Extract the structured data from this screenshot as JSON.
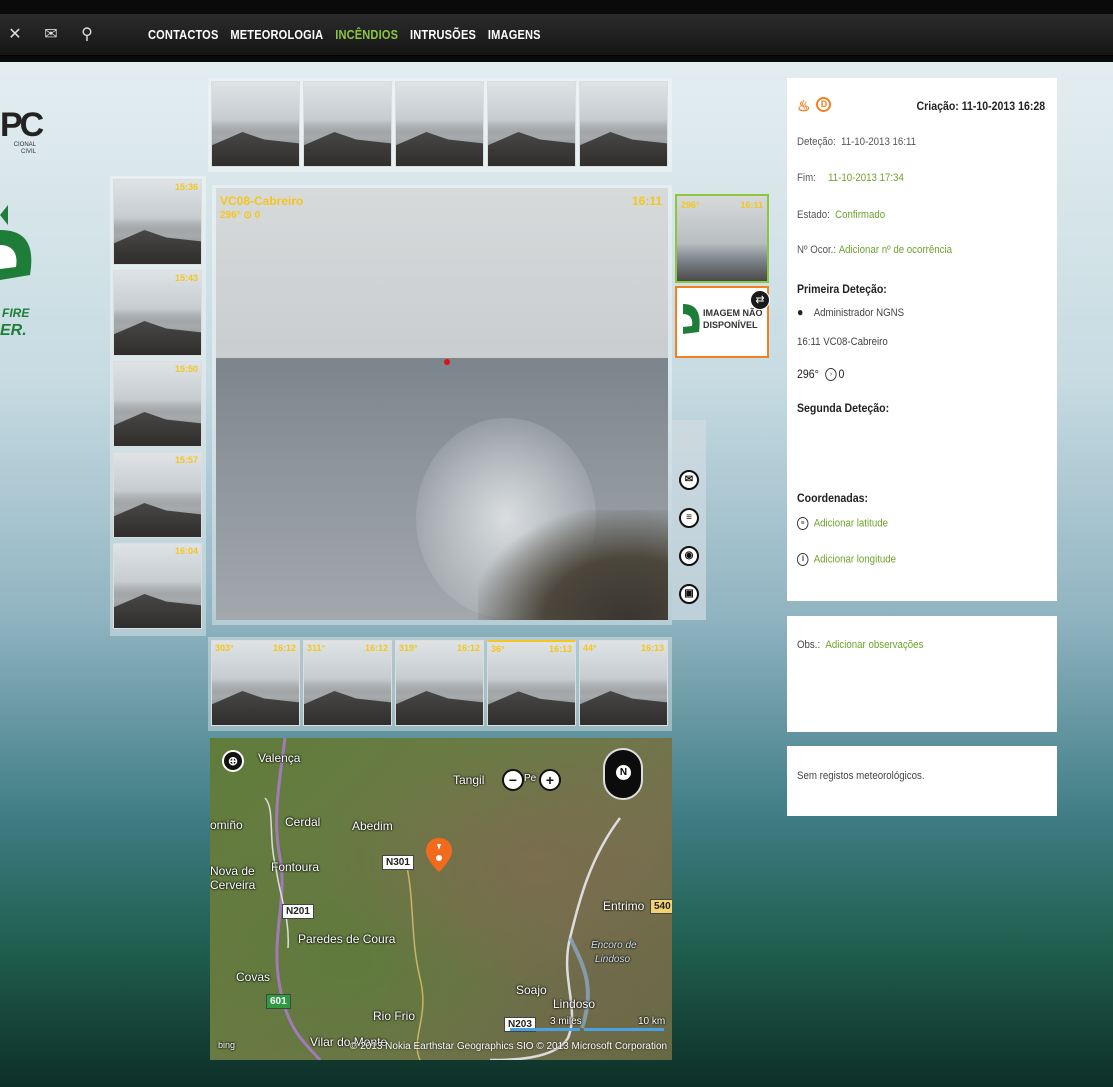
{
  "nav": {
    "icons": [
      "tools-icon",
      "mail-icon",
      "search-icon"
    ],
    "menu": [
      "CONTACTOS",
      "METEOROLOGIA",
      "INCÊNDIOS",
      "INTRUSÕES",
      "IMAGENS"
    ],
    "active": "INCÊNDIOS",
    "accent": "#8cc63f"
  },
  "logos": {
    "pc_text": "PC",
    "pc_sub1": "CIONAL",
    "pc_sub2": "CIVIL",
    "fire_text1": "FIRE",
    "fire_text2": "ER."
  },
  "top_strip": [
    {
      "angle": "",
      "time": ""
    },
    {
      "angle": "",
      "time": ""
    },
    {
      "angle": "",
      "time": ""
    },
    {
      "angle": "",
      "time": ""
    },
    {
      "angle": "",
      "time": ""
    }
  ],
  "left_strip": [
    {
      "angle": "",
      "time": "15:36"
    },
    {
      "angle": "",
      "time": "15:43"
    },
    {
      "angle": "",
      "time": "15:50"
    },
    {
      "angle": "",
      "time": "15:57"
    },
    {
      "angle": "",
      "time": "16:04"
    }
  ],
  "bottom_strip": [
    {
      "angle": "303°",
      "time": "16:12"
    },
    {
      "angle": "311°",
      "time": "16:12"
    },
    {
      "angle": "319°",
      "time": "16:12"
    },
    {
      "angle": "36°",
      "time": "16:13"
    },
    {
      "angle": "44°",
      "time": "16:13"
    }
  ],
  "main_image": {
    "camera": "VC08-Cabreiro",
    "angle": "296°",
    "zoom": "0",
    "time": "16:11"
  },
  "side_thumb": {
    "angle": "296°",
    "time": "16:11"
  },
  "no_image": {
    "line1": "IMAGEM NÃO",
    "line2": "DISPONÍVEL"
  },
  "info": {
    "creation": "Criação: 11-10-2013 16:28",
    "detecao_label": "Deteção:",
    "detecao_value": "11-10-2013 16:11",
    "fim_label": "Fim:",
    "fim_value": "11-10-2013 17:34",
    "estado_label": "Estado:",
    "estado_value": "Confirmado",
    "ocor_label": "Nº Ocor.:",
    "ocor_value": "Adicionar nº de ocorrência",
    "primeira_title": "Primeira Deteção:",
    "user": "Administrador NGNS",
    "camera_line": "16:11  VC08-Cabreiro",
    "angle_line": "296°",
    "zoom_line": "0",
    "segunda_title": "Segunda Deteção:",
    "coord_title": "Coordenadas:",
    "lat": "Adicionar latitude",
    "lon": "Adicionar longitude"
  },
  "obs": {
    "label": "Obs.:",
    "value": "Adicionar observações"
  },
  "meteo": {
    "text": "Sem registos meteorológicos."
  },
  "map": {
    "labels": [
      "Valença",
      "Tangil",
      "Cerdal",
      "Abedim",
      "Fontoura",
      "Nova de",
      "Cerveira",
      "Paredes de Coura",
      "Covas",
      "Rio Frio",
      "Vilar do Monte",
      "Soajo",
      "Lindoso",
      "Entrimo",
      "Encoro de",
      "Lindoso",
      "omiño"
    ],
    "shields": [
      "N301",
      "N201",
      "601",
      "540",
      "N203"
    ],
    "scale_miles": "3 miles",
    "scale_km": "10 km",
    "attribution": "© 2013 Nokia   Earthstar Geographics SIO   © 2013 Microsoft Corporation",
    "compass": "N",
    "zoom_label": "Pe",
    "bing": "bing"
  }
}
